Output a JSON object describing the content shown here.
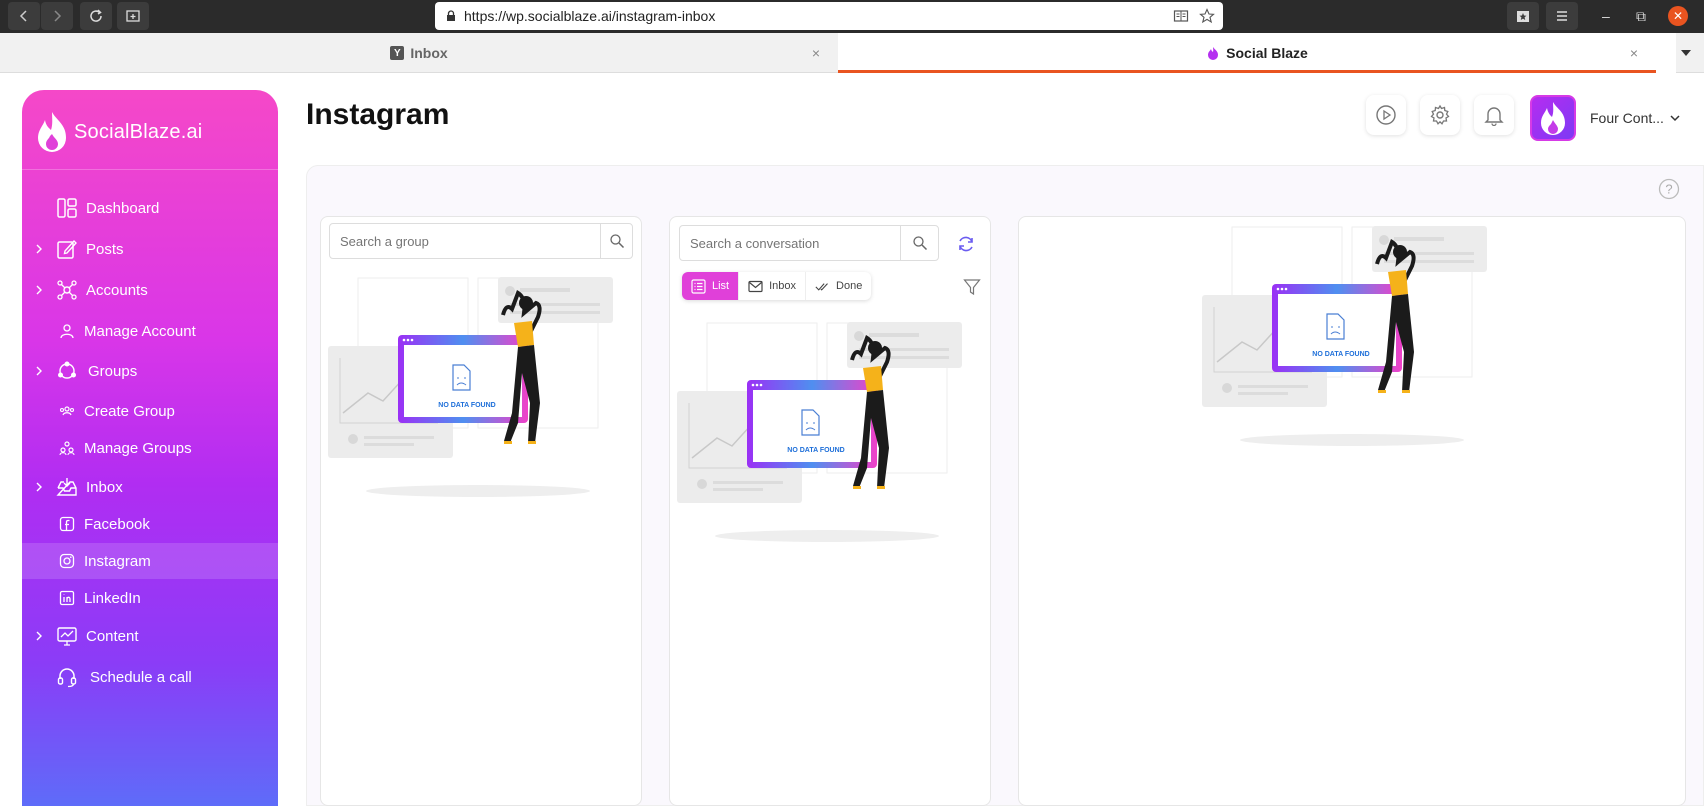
{
  "browser": {
    "url": "https://wp.socialblaze.ai/instagram-inbox",
    "tabs": [
      {
        "label": "Inbox",
        "close": "×"
      },
      {
        "label": "Social Blaze",
        "close": "×"
      }
    ]
  },
  "sidebar": {
    "logo_text": "SocialBlaze.ai",
    "items": [
      {
        "label": "Dashboard"
      },
      {
        "label": "Posts"
      },
      {
        "label": "Accounts"
      },
      {
        "label": "Manage Account"
      },
      {
        "label": "Groups"
      },
      {
        "label": "Create Group"
      },
      {
        "label": "Manage Groups"
      },
      {
        "label": "Inbox"
      },
      {
        "label": "Facebook"
      },
      {
        "label": "Instagram"
      },
      {
        "label": "LinkedIn"
      },
      {
        "label": "Content"
      },
      {
        "label": "Schedule a call"
      }
    ]
  },
  "header": {
    "title": "Instagram",
    "account_name": "Four Cont..."
  },
  "groups_panel": {
    "search_placeholder": "Search a group",
    "empty_text": "NO DATA FOUND"
  },
  "conversations_panel": {
    "search_placeholder": "Search a conversation",
    "filters": [
      {
        "label": "List"
      },
      {
        "label": "Inbox"
      },
      {
        "label": "Done"
      }
    ],
    "empty_text": "NO DATA FOUND"
  },
  "detail_panel": {
    "empty_text": "NO DATA FOUND"
  },
  "colors": {
    "accent": "#e040d9",
    "tab_indicator": "#e95420",
    "link_blue": "#1e6fd9"
  }
}
